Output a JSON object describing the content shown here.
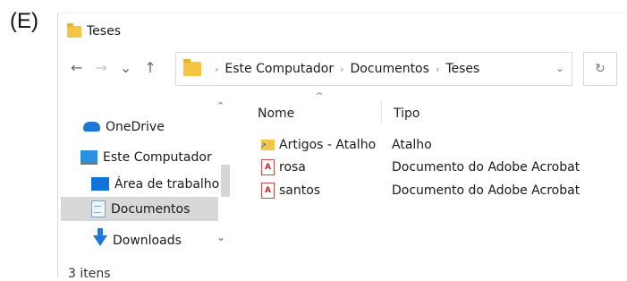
{
  "figure_label": "(E)",
  "window": {
    "title": "Teses"
  },
  "navigation": {
    "back_icon": "arrow-left-icon",
    "forward_icon": "arrow-right-icon",
    "recent_icon": "chevron-down-icon",
    "up_icon": "arrow-up-icon"
  },
  "address_bar": {
    "segments": [
      "Este Computador",
      "Documentos",
      "Teses"
    ]
  },
  "sidebar": {
    "items": [
      {
        "label": "OneDrive",
        "icon": "cloud-icon"
      },
      {
        "label": "Este Computador",
        "icon": "computer-icon"
      },
      {
        "label": "Área de trabalho",
        "icon": "desktop-icon"
      },
      {
        "label": "Documentos",
        "icon": "documents-icon",
        "selected": true
      },
      {
        "label": "Downloads",
        "icon": "download-icon"
      }
    ]
  },
  "file_list": {
    "columns": [
      "Nome",
      "Tipo"
    ],
    "rows": [
      {
        "name": "Artigos - Atalho",
        "type": "Atalho",
        "icon": "shortcut-icon"
      },
      {
        "name": "rosa",
        "type": "Documento do Adobe Acrobat",
        "icon": "pdf-icon"
      },
      {
        "name": "santos",
        "type": "Documento do Adobe Acrobat",
        "icon": "pdf-icon"
      }
    ]
  },
  "status_bar": {
    "item_count": "3 itens"
  },
  "colors": {
    "folder": "#f4c542",
    "selection": "#d8d8d8",
    "pdf": "#c62828",
    "accent": "#1d78d8"
  }
}
